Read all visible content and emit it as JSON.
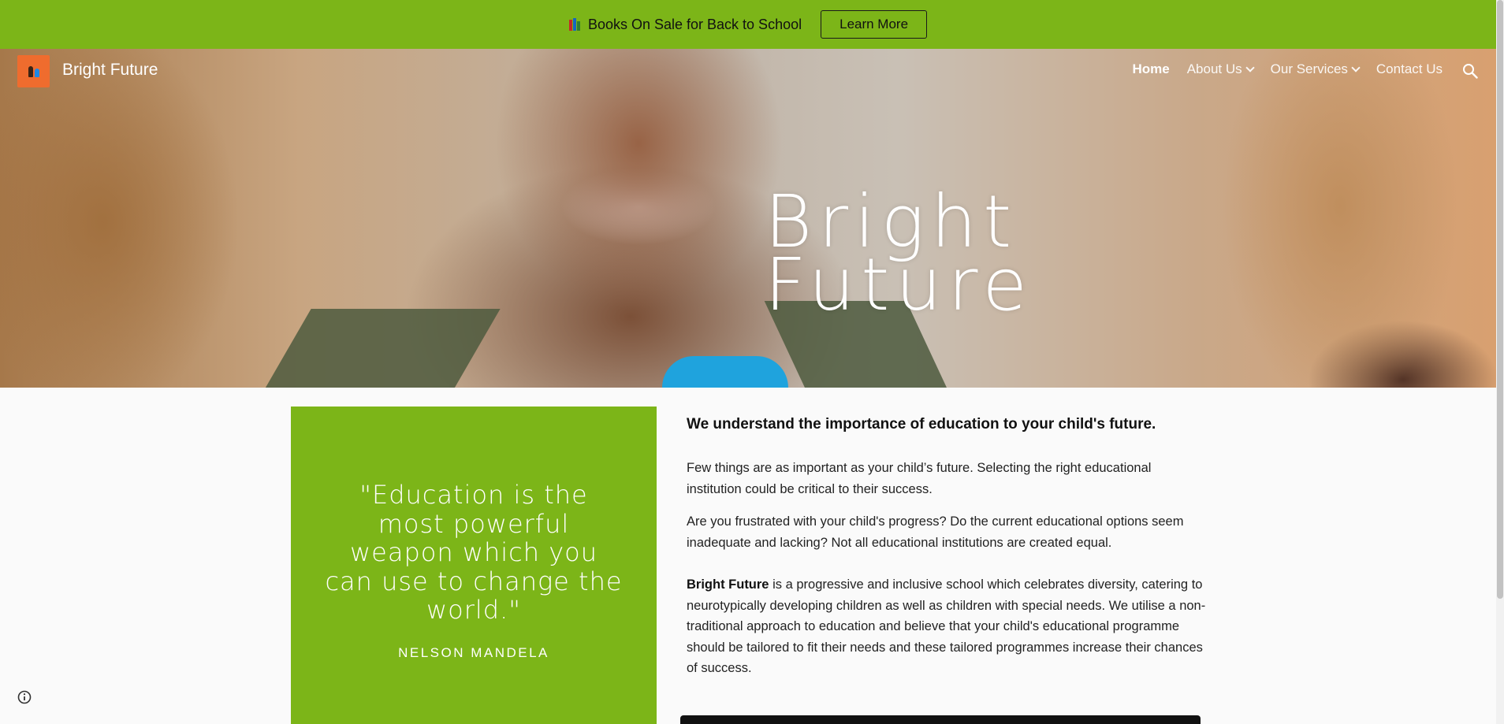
{
  "banner": {
    "text": "Books On Sale for Back to School",
    "icon": "books-icon",
    "button_label": "Learn More",
    "color": "#7cb518"
  },
  "nav": {
    "site_title": "Bright Future",
    "logo": "bright-future-logo",
    "links": [
      {
        "label": "Home",
        "active": true
      },
      {
        "label": "About Us",
        "dropdown": true
      },
      {
        "label": "Our Services",
        "dropdown": true
      },
      {
        "label": "Contact Us"
      }
    ],
    "search_icon": "search-icon"
  },
  "hero": {
    "title_line1": "Bright",
    "title_line2": "Future"
  },
  "quote": {
    "text": "\"Education is the most powerful weapon which you can use to change the world.\"",
    "author": "NELSON MANDELA"
  },
  "article": {
    "heading": "We understand the importance of education to your child's future.",
    "p1": "Few things are as important as your child’s future. Selecting the right educational institution could be critical to their success.",
    "p2": "Are you frustrated with your child's progress? Do the current educational options seem inadequate and lacking? Not all educational institutions are created equal.",
    "p3_bold": "Bright Future",
    "p3": " is a progressive and inclusive school which celebrates diversity, catering to neurotypically developing children as well as children with special needs. We utilise a non-traditional approach to education and believe that your child's educational programme should be tailored to fit their needs and these tailored programmes increase their chances of success."
  },
  "colors": {
    "accent": "#7cb518",
    "logo_bg": "#ef6c2e"
  }
}
